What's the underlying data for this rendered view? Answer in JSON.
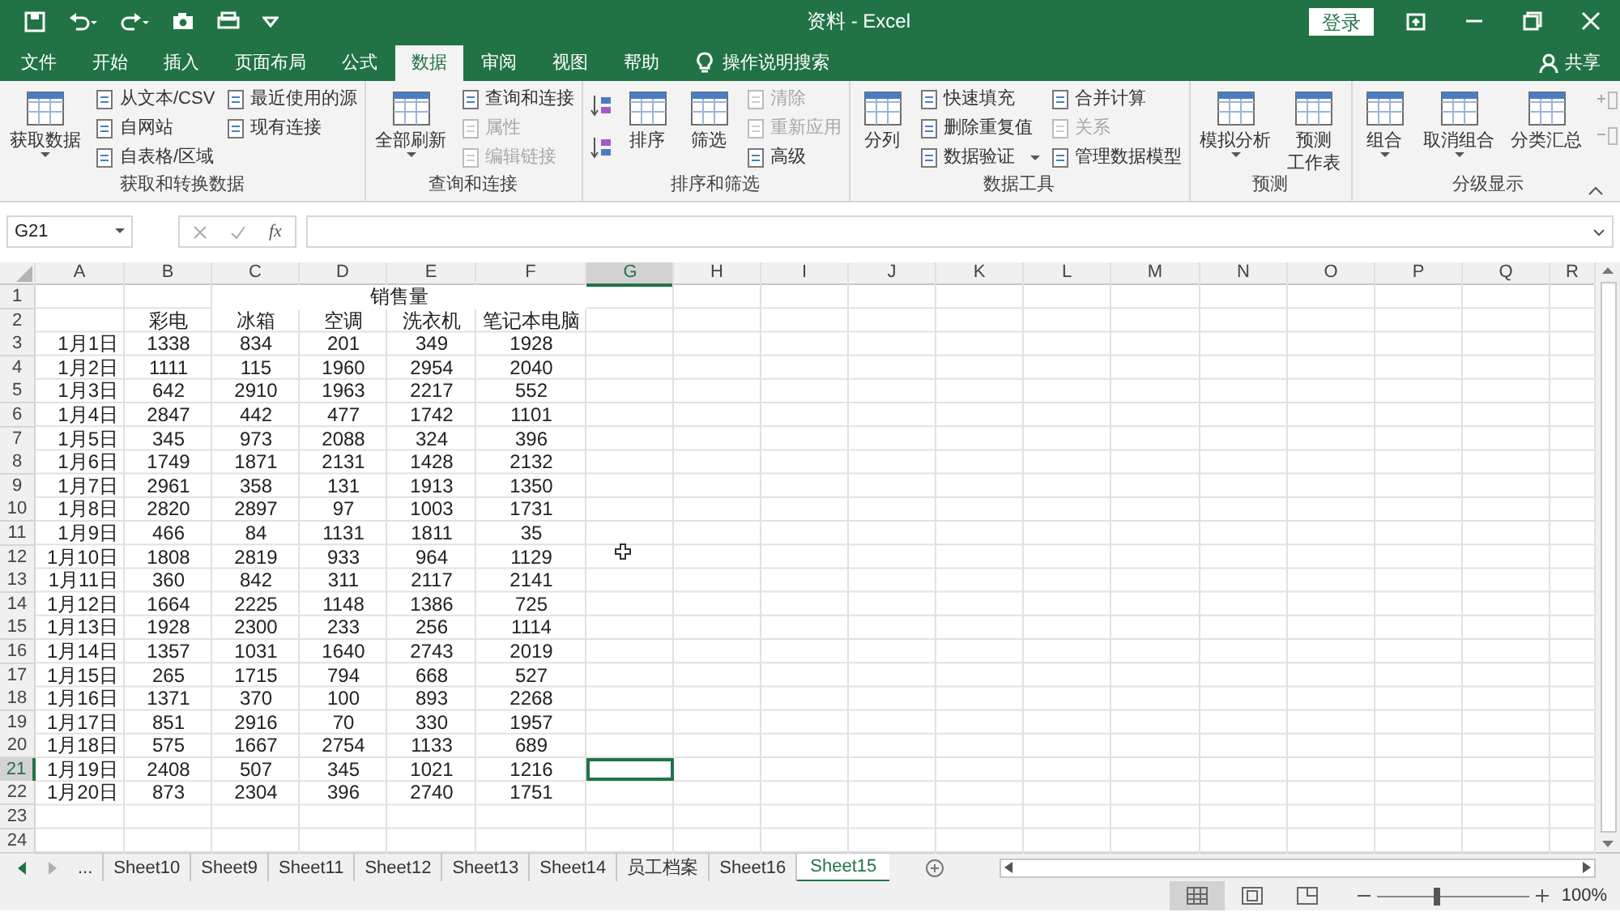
{
  "window": {
    "title": "资料  -  Excel",
    "sign_in": "登录"
  },
  "tabs": [
    {
      "label": "文件",
      "selected": false
    },
    {
      "label": "开始",
      "selected": false
    },
    {
      "label": "插入",
      "selected": false
    },
    {
      "label": "页面布局",
      "selected": false
    },
    {
      "label": "公式",
      "selected": false
    },
    {
      "label": "数据",
      "selected": true
    },
    {
      "label": "审阅",
      "selected": false
    },
    {
      "label": "视图",
      "selected": false
    },
    {
      "label": "帮助",
      "selected": false
    }
  ],
  "search_hint": "操作说明搜索",
  "share": "共享",
  "ribbon": {
    "groups": [
      {
        "label": "获取和转换数据",
        "columns": [
          {
            "kind": "large",
            "label": "获取数据",
            "dropdown": true
          },
          {
            "kind": "small",
            "items": [
              {
                "label": "从文本/CSV",
                "disabled": false,
                "dropdown": false
              },
              {
                "label": "自网站",
                "disabled": false,
                "dropdown": false
              },
              {
                "label": "自表格/区域",
                "disabled": false,
                "dropdown": false
              }
            ]
          },
          {
            "kind": "small",
            "items": [
              {
                "label": "最近使用的源",
                "disabled": false,
                "dropdown": false
              },
              {
                "label": "现有连接",
                "disabled": false,
                "dropdown": false
              }
            ]
          }
        ]
      },
      {
        "label": "查询和连接",
        "columns": [
          {
            "kind": "large",
            "label": "全部刷新",
            "dropdown": true
          },
          {
            "kind": "small",
            "items": [
              {
                "label": "查询和连接",
                "disabled": false,
                "dropdown": false
              },
              {
                "label": "属性",
                "disabled": true,
                "dropdown": false
              },
              {
                "label": "编辑链接",
                "disabled": true,
                "dropdown": false
              }
            ]
          }
        ]
      },
      {
        "label": "排序和筛选",
        "columns": [
          {
            "kind": "sort"
          },
          {
            "kind": "large",
            "label": "排序",
            "dropdown": false
          },
          {
            "kind": "large",
            "label": "筛选",
            "dropdown": false
          },
          {
            "kind": "small",
            "items": [
              {
                "label": "清除",
                "disabled": true,
                "dropdown": false
              },
              {
                "label": "重新应用",
                "disabled": true,
                "dropdown": false
              },
              {
                "label": "高级",
                "disabled": false,
                "dropdown": false
              }
            ]
          }
        ]
      },
      {
        "label": "数据工具",
        "columns": [
          {
            "kind": "large",
            "label": "分列",
            "dropdown": false
          },
          {
            "kind": "small",
            "items": [
              {
                "label": "快速填充",
                "disabled": false,
                "dropdown": false
              },
              {
                "label": "删除重复值",
                "disabled": false,
                "dropdown": false
              },
              {
                "label": "数据验证",
                "disabled": false,
                "dropdown": true
              }
            ]
          },
          {
            "kind": "small",
            "items": [
              {
                "label": "合并计算",
                "disabled": false,
                "dropdown": false
              },
              {
                "label": "关系",
                "disabled": true,
                "dropdown": false
              },
              {
                "label": "管理数据模型",
                "disabled": false,
                "dropdown": false
              }
            ]
          }
        ]
      },
      {
        "label": "预测",
        "columns": [
          {
            "kind": "large",
            "label": "模拟分析",
            "dropdown": true
          },
          {
            "kind": "large",
            "lines": [
              "预测",
              "工作表"
            ],
            "dropdown": false
          }
        ]
      },
      {
        "label": "分级显示",
        "columns": [
          {
            "kind": "large",
            "label": "组合",
            "dropdown": true
          },
          {
            "kind": "large",
            "label": "取消组合",
            "dropdown": true
          },
          {
            "kind": "large",
            "label": "分类汇总",
            "dropdown": false
          },
          {
            "kind": "outline"
          }
        ]
      }
    ]
  },
  "formula_bar": {
    "name_box": "G21",
    "fx": "fx"
  },
  "sheet": {
    "columns": [
      {
        "label": "A",
        "selected": false
      },
      {
        "label": "B",
        "selected": false
      },
      {
        "label": "C",
        "selected": false
      },
      {
        "label": "D",
        "selected": false
      },
      {
        "label": "E",
        "selected": false
      },
      {
        "label": "F",
        "selected": false
      },
      {
        "label": "G",
        "selected": true
      },
      {
        "label": "H",
        "selected": false
      },
      {
        "label": "I",
        "selected": false
      },
      {
        "label": "J",
        "selected": false
      },
      {
        "label": "K",
        "selected": false
      },
      {
        "label": "L",
        "selected": false
      },
      {
        "label": "M",
        "selected": false
      },
      {
        "label": "N",
        "selected": false
      },
      {
        "label": "O",
        "selected": false
      },
      {
        "label": "P",
        "selected": false
      },
      {
        "label": "Q",
        "selected": false
      },
      {
        "label": "R",
        "selected": false
      }
    ],
    "row_numbers": [
      {
        "label": "1",
        "selected": false
      },
      {
        "label": "2",
        "selected": false
      },
      {
        "label": "3",
        "selected": false
      },
      {
        "label": "4",
        "selected": false
      },
      {
        "label": "5",
        "selected": false
      },
      {
        "label": "6",
        "selected": false
      },
      {
        "label": "7",
        "selected": false
      },
      {
        "label": "8",
        "selected": false
      },
      {
        "label": "9",
        "selected": false
      },
      {
        "label": "10",
        "selected": false
      },
      {
        "label": "11",
        "selected": false
      },
      {
        "label": "12",
        "selected": false
      },
      {
        "label": "13",
        "selected": false
      },
      {
        "label": "14",
        "selected": false
      },
      {
        "label": "15",
        "selected": false
      },
      {
        "label": "16",
        "selected": false
      },
      {
        "label": "17",
        "selected": false
      },
      {
        "label": "18",
        "selected": false
      },
      {
        "label": "19",
        "selected": false
      },
      {
        "label": "20",
        "selected": false
      },
      {
        "label": "21",
        "selected": true
      },
      {
        "label": "22",
        "selected": false
      },
      {
        "label": "23",
        "selected": false
      },
      {
        "label": "24",
        "selected": false
      }
    ],
    "merged_title": "销售量",
    "header_row": [
      "彩电",
      "冰箱",
      "空调",
      "洗衣机",
      "笔记本电脑"
    ],
    "rows": [
      {
        "date": "1月1日",
        "values": [
          "1338",
          "834",
          "201",
          "349",
          "1928"
        ]
      },
      {
        "date": "1月2日",
        "values": [
          "1111",
          "115",
          "1960",
          "2954",
          "2040"
        ]
      },
      {
        "date": "1月3日",
        "values": [
          "642",
          "2910",
          "1963",
          "2217",
          "552"
        ]
      },
      {
        "date": "1月4日",
        "values": [
          "2847",
          "442",
          "477",
          "1742",
          "1101"
        ]
      },
      {
        "date": "1月5日",
        "values": [
          "345",
          "973",
          "2088",
          "324",
          "396"
        ]
      },
      {
        "date": "1月6日",
        "values": [
          "1749",
          "1871",
          "2131",
          "1428",
          "2132"
        ]
      },
      {
        "date": "1月7日",
        "values": [
          "2961",
          "358",
          "131",
          "1913",
          "1350"
        ]
      },
      {
        "date": "1月8日",
        "values": [
          "2820",
          "2897",
          "97",
          "1003",
          "1731"
        ]
      },
      {
        "date": "1月9日",
        "values": [
          "466",
          "84",
          "1131",
          "1811",
          "35"
        ]
      },
      {
        "date": "1月10日",
        "values": [
          "1808",
          "2819",
          "933",
          "964",
          "1129"
        ]
      },
      {
        "date": "1月11日",
        "values": [
          "360",
          "842",
          "311",
          "2117",
          "2141"
        ]
      },
      {
        "date": "1月12日",
        "values": [
          "1664",
          "2225",
          "1148",
          "1386",
          "725"
        ]
      },
      {
        "date": "1月13日",
        "values": [
          "1928",
          "2300",
          "233",
          "256",
          "1114"
        ]
      },
      {
        "date": "1月14日",
        "values": [
          "1357",
          "1031",
          "1640",
          "2743",
          "2019"
        ]
      },
      {
        "date": "1月15日",
        "values": [
          "265",
          "1715",
          "794",
          "668",
          "527"
        ]
      },
      {
        "date": "1月16日",
        "values": [
          "1371",
          "370",
          "100",
          "893",
          "2268"
        ]
      },
      {
        "date": "1月17日",
        "values": [
          "851",
          "2916",
          "70",
          "330",
          "1957"
        ]
      },
      {
        "date": "1月18日",
        "values": [
          "575",
          "1667",
          "2754",
          "1133",
          "689"
        ]
      },
      {
        "date": "1月19日",
        "values": [
          "2408",
          "507",
          "345",
          "1021",
          "1216"
        ]
      },
      {
        "date": "1月20日",
        "values": [
          "873",
          "2304",
          "396",
          "2740",
          "1751"
        ]
      }
    ]
  },
  "sheet_tabs": [
    {
      "label": "...",
      "selected": false
    },
    {
      "label": "Sheet10",
      "selected": false
    },
    {
      "label": "Sheet9",
      "selected": false
    },
    {
      "label": "Sheet11",
      "selected": false
    },
    {
      "label": "Sheet12",
      "selected": false
    },
    {
      "label": "Sheet13",
      "selected": false
    },
    {
      "label": "Sheet14",
      "selected": false
    },
    {
      "label": "员工档案",
      "selected": false
    },
    {
      "label": "Sheet16",
      "selected": false
    },
    {
      "label": "Sheet15",
      "selected": true
    }
  ],
  "status_bar": {
    "views": [
      {
        "kind": "normal",
        "selected": true
      },
      {
        "kind": "page_layout",
        "selected": false
      },
      {
        "kind": "page_break",
        "selected": false
      }
    ],
    "zoom": {
      "level": 0.4,
      "reading": "100%"
    }
  }
}
